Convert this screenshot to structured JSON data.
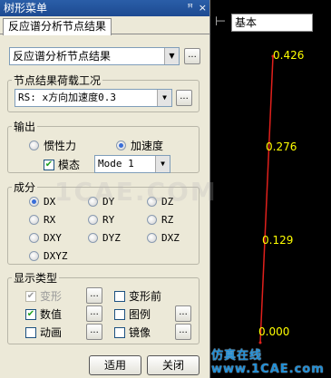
{
  "window": {
    "title": "树形菜单",
    "pin_glyph": "ꟸ",
    "close_glyph": "×"
  },
  "tab": {
    "label": "反应谱分析节点结果"
  },
  "main_select": {
    "value": "反应谱分析节点结果",
    "dots": "..."
  },
  "load_case": {
    "legend": "节点结果荷载工况",
    "value": "RS: x方向加速度0.3",
    "dots": "..."
  },
  "output": {
    "legend": "输出",
    "options": [
      {
        "label": "惯性力",
        "selected": false
      },
      {
        "label": "加速度",
        "selected": true
      }
    ],
    "mode_check": {
      "label": "模态",
      "checked": true
    },
    "mode_select": "Mode 1"
  },
  "component": {
    "legend": "成分",
    "options": [
      {
        "label": "DX",
        "selected": true
      },
      {
        "label": "DY",
        "selected": false
      },
      {
        "label": "DZ",
        "selected": false
      },
      {
        "label": "RX",
        "selected": false
      },
      {
        "label": "RY",
        "selected": false
      },
      {
        "label": "RZ",
        "selected": false
      },
      {
        "label": "DXY",
        "selected": false
      },
      {
        "label": "DYZ",
        "selected": false
      },
      {
        "label": "DXZ",
        "selected": false
      },
      {
        "label": "DXYZ",
        "selected": false
      }
    ]
  },
  "display": {
    "legend": "显示类型",
    "items": [
      {
        "label": "变形",
        "checked": true,
        "disabled": true
      },
      {
        "label": "变形前",
        "checked": false,
        "disabled": false
      },
      {
        "label": "数值",
        "checked": true,
        "disabled": false
      },
      {
        "label": "图例",
        "checked": false,
        "disabled": false
      },
      {
        "label": "动画",
        "checked": false,
        "disabled": false
      },
      {
        "label": "镜像",
        "checked": false,
        "disabled": false
      }
    ],
    "dots": "..."
  },
  "buttons": {
    "apply": "适用",
    "close": "关闭"
  },
  "viewport": {
    "view_select": "基本",
    "values": [
      "0.426",
      "0.276",
      "0.129",
      "0.000"
    ],
    "line_color": "#e0201c",
    "value_color": "#ffff00"
  },
  "watermarks": {
    "bottom": "仿真在线 www.1CAE.com",
    "background": "1CAE.COM"
  }
}
